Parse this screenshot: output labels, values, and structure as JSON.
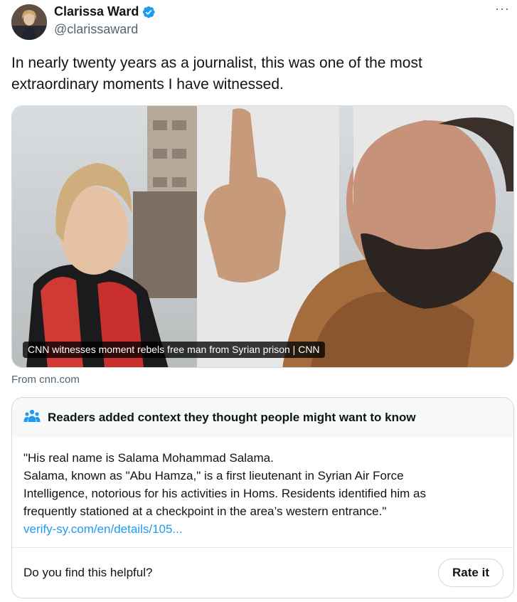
{
  "author": {
    "name": "Clarissa Ward",
    "handle": "@clarissaward",
    "verified_color": "#1d9bf0"
  },
  "more_label": "···",
  "tweet": {
    "line1": "In nearly twenty years as a journalist, this was one of the most",
    "line2": "extraordinary moments I have witnessed."
  },
  "media": {
    "caption": "CNN witnesses moment rebels free man from Syrian prison | CNN",
    "source": "From cnn.com"
  },
  "community_note": {
    "heading": "Readers added context they thought people might want to know",
    "line1": "\"His real name is Salama Mohammad Salama.",
    "line2": "Salama, known as \"Abu Hamza,\" is a first lieutenant in Syrian Air Force",
    "line3": "Intelligence, notorious for his activities in Homs. Residents identified him as",
    "line4": "frequently stationed at a checkpoint in the area’s western entrance.\"",
    "link": "verify-sy.com/en/details/105...",
    "question": "Do you find this helpful?",
    "rate_label": "Rate it",
    "icon_color": "#1d9bf0"
  }
}
